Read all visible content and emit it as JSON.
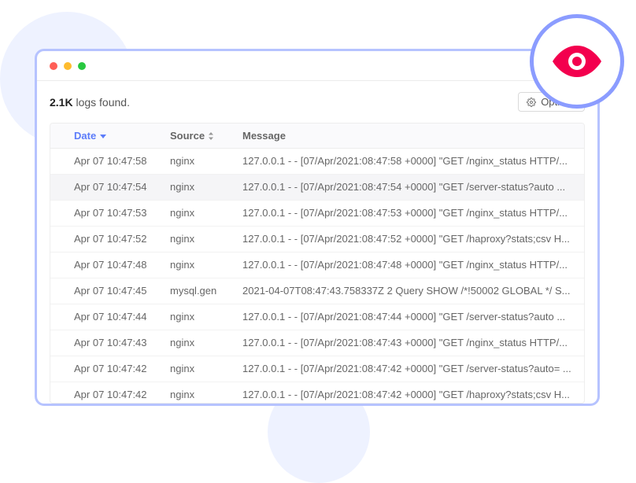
{
  "header": {
    "count": "2.1K",
    "suffix": "logs found.",
    "options_label": "Options"
  },
  "columns": {
    "date": "Date",
    "source": "Source",
    "message": "Message"
  },
  "rows": [
    {
      "color": "green",
      "date": "Apr 07 10:47:58",
      "source": "nginx",
      "msg": "127.0.0.1 - - [07/Apr/2021:08:47:58 +0000] \"GET /nginx_status HTTP/..."
    },
    {
      "color": "green",
      "date": "Apr 07 10:47:54",
      "source": "nginx",
      "msg": "127.0.0.1 - - [07/Apr/2021:08:47:54 +0000] \"GET /server-status?auto ...",
      "hover": true
    },
    {
      "color": "green",
      "date": "Apr 07 10:47:53",
      "source": "nginx",
      "msg": "127.0.0.1 - - [07/Apr/2021:08:47:53 +0000] \"GET /nginx_status HTTP/..."
    },
    {
      "color": "green",
      "date": "Apr 07 10:47:52",
      "source": "nginx",
      "msg": "127.0.0.1 - - [07/Apr/2021:08:47:52 +0000] \"GET /haproxy?stats;csv H..."
    },
    {
      "color": "green",
      "date": "Apr 07 10:47:48",
      "source": "nginx",
      "msg": "127.0.0.1 - - [07/Apr/2021:08:47:48 +0000] \"GET /nginx_status HTTP/..."
    },
    {
      "color": "blue",
      "date": "Apr 07 10:47:45",
      "source": "mysql.gen",
      "msg": "2021-04-07T08:47:43.758337Z 2 Query SHOW /*!50002 GLOBAL */ S..."
    },
    {
      "color": "green",
      "date": "Apr 07 10:47:44",
      "source": "nginx",
      "msg": "127.0.0.1 - - [07/Apr/2021:08:47:44 +0000] \"GET /server-status?auto ..."
    },
    {
      "color": "green",
      "date": "Apr 07 10:47:43",
      "source": "nginx",
      "msg": "127.0.0.1 - - [07/Apr/2021:08:47:43 +0000] \"GET /nginx_status HTTP/..."
    },
    {
      "color": "green",
      "date": "Apr 07 10:47:42",
      "source": "nginx",
      "msg": "127.0.0.1 - - [07/Apr/2021:08:47:42 +0000] \"GET /server-status?auto= ..."
    },
    {
      "color": "green",
      "date": "Apr 07 10:47:42",
      "source": "nginx",
      "msg": "127.0.0.1 - - [07/Apr/2021:08:47:42 +0000] \"GET /haproxy?stats;csv H..."
    }
  ]
}
